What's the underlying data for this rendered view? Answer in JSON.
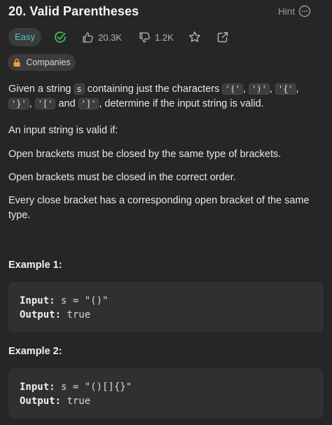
{
  "problem": {
    "title": "20. Valid Parentheses",
    "hint_label": "Hint",
    "more_icon": "more-options-icon"
  },
  "meta": {
    "difficulty": "Easy",
    "difficulty_color": "#46c6c2",
    "solved_icon": "check-circle-icon",
    "likes": "20.3K",
    "dislikes": "1.2K",
    "star_icon": "star-icon",
    "share_icon": "share-icon"
  },
  "companies": {
    "label": "Companies",
    "icon": "lock-icon"
  },
  "description": {
    "intro_before_s": "Given a string ",
    "var_s": "s",
    "intro_after_s": " containing just the characters ",
    "chars": [
      "'('",
      "')'",
      "'{'",
      "'}'",
      "'['",
      "']'"
    ],
    "sep1": ", ",
    "sep2": ", ",
    "sep3": ", ",
    "sep4": ",",
    "sep_and": " and ",
    "intro_end": ", determine if the input string is valid.",
    "valid_if": "An input string is valid if:",
    "rule1": "Open brackets must be closed by the same type of brackets.",
    "rule2": "Open brackets must be closed in the correct order.",
    "rule3": "Every close bracket has a corresponding open bracket of the same type."
  },
  "examples": [
    {
      "title": "Example 1:",
      "input_label": "Input:",
      "input_value": " s = \"()\"",
      "output_label": "Output:",
      "output_value": " true"
    },
    {
      "title": "Example 2:",
      "input_label": "Input:",
      "input_value": " s = \"()[]{}\"",
      "output_label": "Output:",
      "output_value": " true"
    }
  ]
}
